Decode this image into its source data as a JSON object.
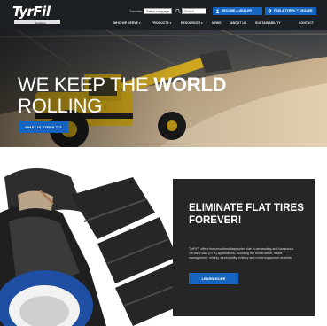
{
  "header": {
    "logo_text": "TyrFil",
    "logo_subtext": "Resilient",
    "translate_label": "Translate",
    "language_select_value": "Select Language",
    "search_placeholder": "Search",
    "become_dealer_label": "BECOME A DEALER",
    "find_dealer_label": "FIND A TYRFIL™ DEALER",
    "nav": [
      {
        "label": "WHO WE SERVE",
        "has_dropdown": true
      },
      {
        "label": "PRODUCTS",
        "has_dropdown": true
      },
      {
        "label": "RESOURCES",
        "has_dropdown": true
      },
      {
        "label": "NEWS",
        "has_dropdown": false
      },
      {
        "label": "ABOUT US",
        "has_dropdown": false
      },
      {
        "label": "SUSTAINABILITY",
        "has_dropdown": false
      },
      {
        "label": "CONTACT",
        "has_dropdown": false
      }
    ]
  },
  "hero": {
    "title_part1": "WE KEEP THE ",
    "title_bold": "WORLD",
    "title_part2": "ROLLING",
    "cta_label": "WHAT IS TYRFIL™?"
  },
  "feature": {
    "title": "ELIMINATE FLAT TIRES FOREVER!",
    "body": "TyrFil™ offers the smoothest flatproofed ride in demanding and hazardous Off-the-Road (OTR) applications, including the construction, waste management, mining, municipality, military and rental equipment markets.",
    "cta_label": "LEARN MORE"
  },
  "colors": {
    "header_bg": "#1c1f24",
    "accent_blue": "#1565c0",
    "panel_bg": "#262626"
  },
  "icons": [
    "search-icon",
    "user-icon",
    "map-pin-icon",
    "chevron-down-icon"
  ]
}
